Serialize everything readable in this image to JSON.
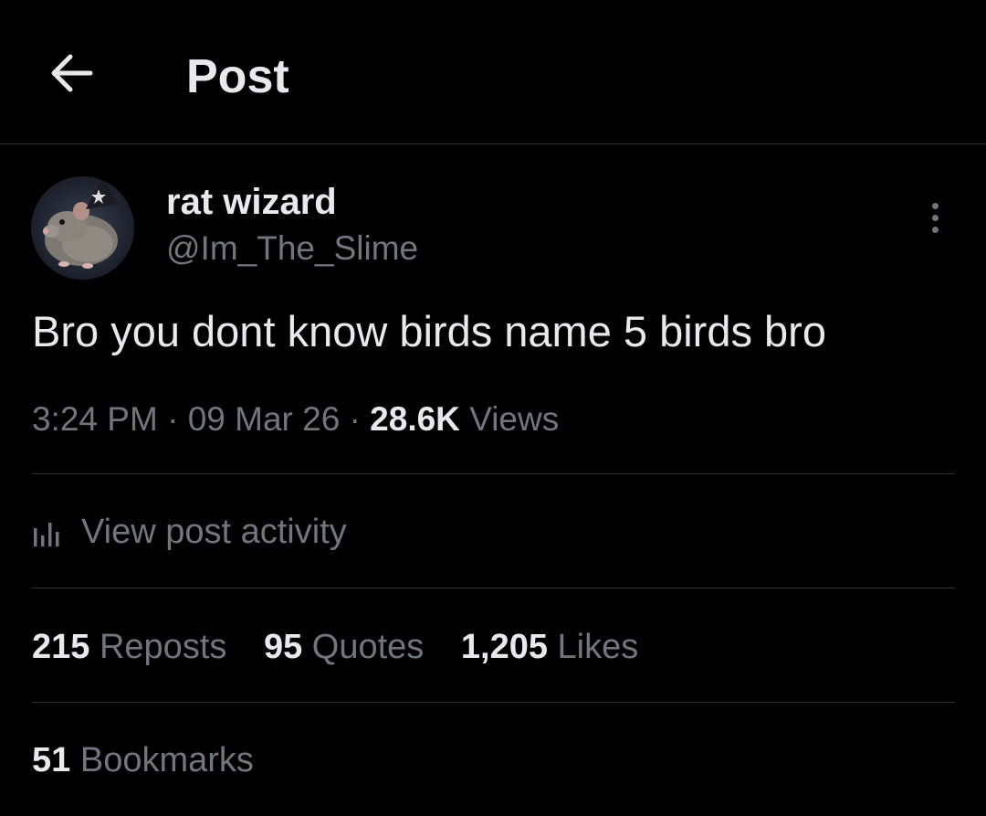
{
  "header": {
    "back_icon": "arrow-left-icon",
    "title": "Post"
  },
  "author": {
    "display_name": "rat wizard",
    "handle": "@Im_The_Slime",
    "avatar_icon": "rat-wizard-avatar"
  },
  "post": {
    "text": "Bro you dont know birds name 5 birds bro",
    "time": "3:24 PM",
    "date": "09 Mar 26",
    "views_count": "28.6K",
    "views_label": "Views",
    "separator": "·"
  },
  "activity": {
    "icon": "bar-chart-icon",
    "label": "View post activity"
  },
  "stats": {
    "reposts_count": "215",
    "reposts_label": "Reposts",
    "quotes_count": "95",
    "quotes_label": "Quotes",
    "likes_count": "1,205",
    "likes_label": "Likes",
    "bookmarks_count": "51",
    "bookmarks_label": "Bookmarks"
  },
  "colors": {
    "background": "#000000",
    "primary_text": "#e7e9ea",
    "secondary_text": "#71767b",
    "divider": "#2f3336"
  }
}
